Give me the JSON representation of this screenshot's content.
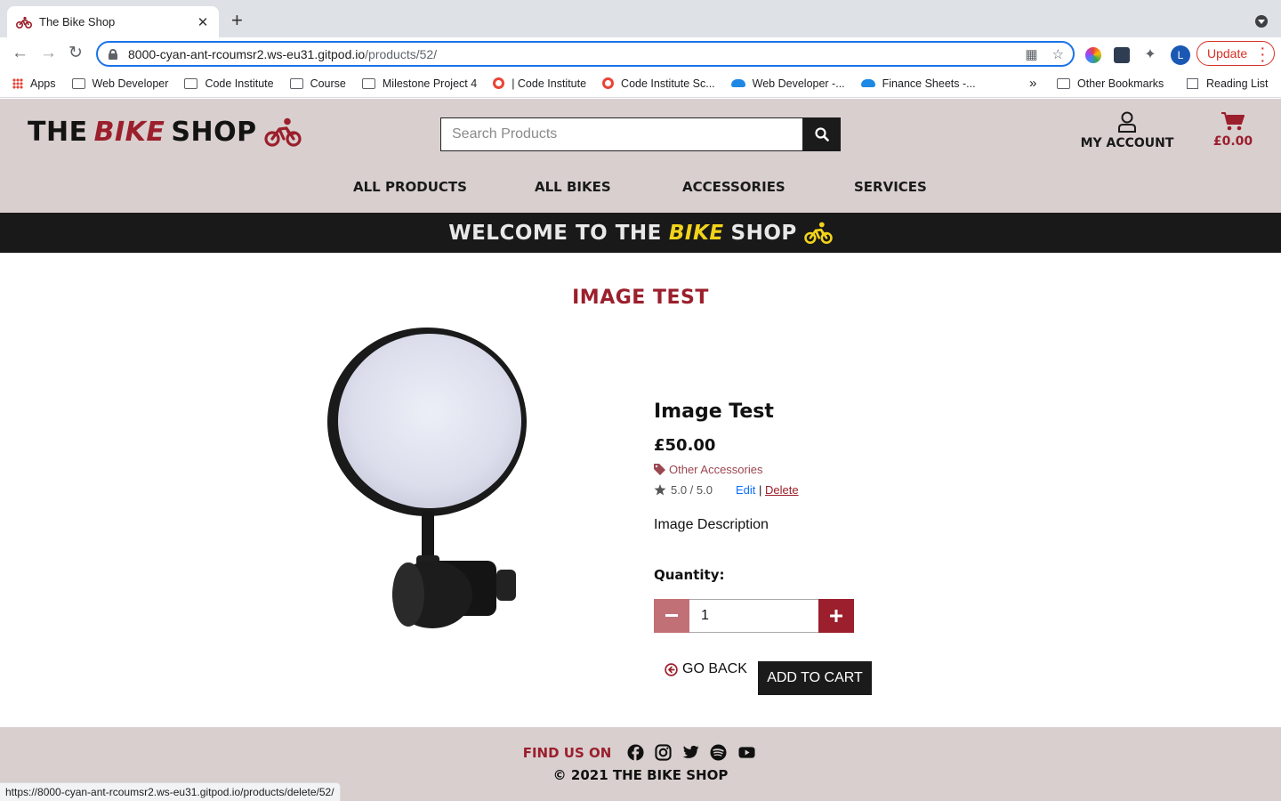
{
  "browser": {
    "tab_title": "The Bike Shop",
    "url_host": "8000-cyan-ant-rcoumsr2.ws-eu31.gitpod.io",
    "url_path": "/products/52/",
    "update_label": "Update",
    "profile_initial": "L",
    "bookmarks": [
      "Apps",
      "Web Developer",
      "Code Institute",
      "Course",
      "Milestone Project 4",
      "| Code Institute",
      "Code Institute Sc...",
      "Web Developer -...",
      "Finance Sheets -..."
    ],
    "bookmarks_overflow": "»",
    "other_bookmarks": "Other Bookmarks",
    "reading_list": "Reading List",
    "status_url": "https://8000-cyan-ant-rcoumsr2.ws-eu31.gitpod.io/products/delete/52/"
  },
  "header": {
    "logo_the": "THE",
    "logo_bike": "BIKE",
    "logo_shop": "SHOP",
    "search_placeholder": "Search Products",
    "account_label": "MY ACCOUNT",
    "cart_total": "£0.00",
    "nav": [
      "ALL PRODUCTS",
      "ALL BIKES",
      "ACCESSORIES",
      "SERVICES"
    ]
  },
  "banner": {
    "prefix": "WELCOME TO THE",
    "bike": "BIKE",
    "suffix": "SHOP"
  },
  "product": {
    "page_title": "IMAGE TEST",
    "name": "Image Test",
    "price": "£50.00",
    "category": "Other Accessories",
    "rating": "5.0 / 5.0",
    "edit_label": "Edit",
    "separator": "|",
    "delete_label": "Delete",
    "description": "Image Description",
    "quantity_label": "Quantity:",
    "quantity_value": "1",
    "go_back_label": "GO BACK",
    "add_to_cart_label": "ADD TO CART"
  },
  "footer": {
    "find_us": "FIND US ON",
    "copyright": "© 2021 THE BIKE SHOP",
    "social_icons": [
      "facebook-icon",
      "instagram-icon",
      "twitter-icon",
      "spotify-icon",
      "youtube-icon"
    ]
  },
  "colors": {
    "brand_red": "#9b1f2c",
    "brand_yellow": "#f2d31b",
    "header_bg": "#d9cfcf",
    "dark": "#1b1b1b"
  }
}
